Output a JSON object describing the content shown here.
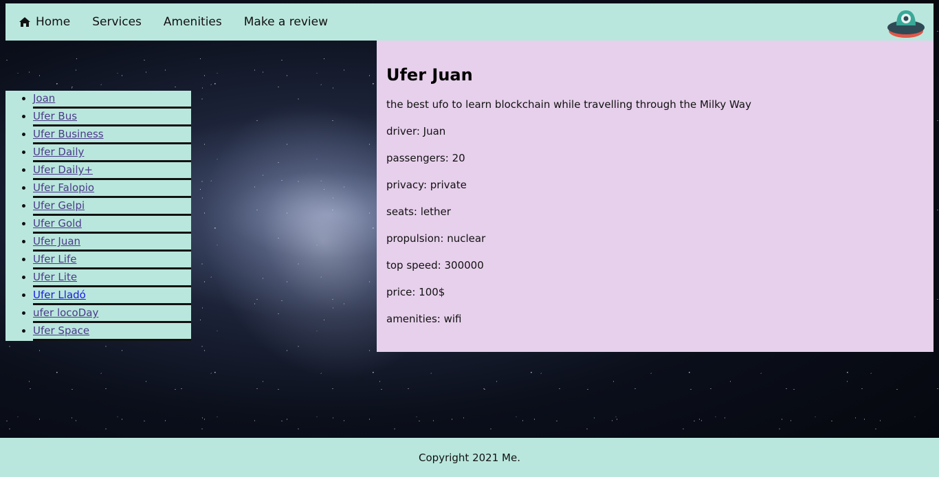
{
  "nav": {
    "items": [
      {
        "label": "Home",
        "icon": "home-icon"
      },
      {
        "label": "Services"
      },
      {
        "label": "Amenities"
      },
      {
        "label": "Make a review"
      }
    ],
    "logo_icon": "ufo-logo-icon"
  },
  "sidebar": {
    "items": [
      {
        "label": "Joan"
      },
      {
        "label": "Ufer Bus"
      },
      {
        "label": "Ufer Business"
      },
      {
        "label": "Ufer Daily"
      },
      {
        "label": "Ufer Daily+"
      },
      {
        "label": "Ufer Falopio"
      },
      {
        "label": "Ufer Gelpi"
      },
      {
        "label": "Ufer Gold"
      },
      {
        "label": "Ufer Juan"
      },
      {
        "label": "Ufer Life"
      },
      {
        "label": "Ufer Lite"
      },
      {
        "label": "Ufer Lladó"
      },
      {
        "label": "ufer locoDay"
      },
      {
        "label": "Ufer Space"
      }
    ]
  },
  "detail": {
    "title": "Ufer Juan",
    "description": "the best ufo to learn blockchain while travelling through the Milky Way",
    "driver": "driver: Juan",
    "passengers": "passengers: 20",
    "privacy": "privacy: private",
    "seats": "seats: lether",
    "propulsion": "propulsion: nuclear",
    "top_speed": "top speed: 300000",
    "price": "price: 100$",
    "amenities": "amenities: wifi"
  },
  "footer": {
    "text": "Copyright 2021 Me."
  },
  "colors": {
    "nav_bg": "#bae7dd",
    "content_bg": "#e7d0ec",
    "link": "#4b3a8a",
    "link_active": "#1a1ae0"
  }
}
